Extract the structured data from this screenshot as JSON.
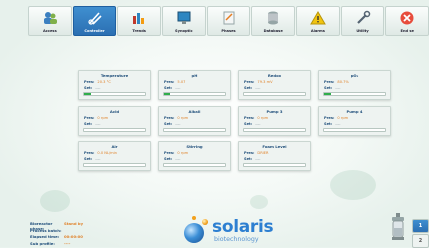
{
  "toolbar": {
    "items": [
      {
        "label": "Access",
        "icon": "people-icon",
        "active": false
      },
      {
        "label": "Controller",
        "icon": "controller-icon",
        "active": true
      },
      {
        "label": "Trends",
        "icon": "trends-icon",
        "active": false
      },
      {
        "label": "Synoptic",
        "icon": "synoptic-icon",
        "active": false
      },
      {
        "label": "Phases",
        "icon": "phases-icon",
        "active": false
      },
      {
        "label": "Database",
        "icon": "database-icon",
        "active": false
      },
      {
        "label": "Alarms",
        "icon": "alarm-icon",
        "active": false
      },
      {
        "label": "Utility",
        "icon": "utility-icon",
        "active": false
      },
      {
        "label": "End se",
        "icon": "end-session-icon",
        "active": false
      }
    ]
  },
  "cards": [
    {
      "title": "Temperature",
      "pres_label": "Pres:",
      "pres_value": "20.3 °C",
      "set_label": "Set:",
      "set_value": "----",
      "fill": 0.12
    },
    {
      "title": "pH",
      "pres_label": "Pres:",
      "pres_value": "5.07",
      "set_label": "Set:",
      "set_value": "----",
      "fill": 0.1
    },
    {
      "title": "Redox",
      "pres_label": "Pres:",
      "pres_value": "79.3 mV",
      "set_label": "Set:",
      "set_value": "----",
      "fill": 0
    },
    {
      "title": "pO₂",
      "pres_label": "Pres:",
      "pres_value": "80.7%",
      "set_label": "Set:",
      "set_value": "----",
      "fill": 0.12
    },
    {
      "title": "Acid",
      "pres_label": "Pres:",
      "pres_value": "0 rpm",
      "set_label": "Set:",
      "set_value": "----",
      "fill": 0
    },
    {
      "title": "Alkali",
      "pres_label": "Pres:",
      "pres_value": "0 rpm",
      "set_label": "Set:",
      "set_value": "----",
      "fill": 0
    },
    {
      "title": "Pump 3",
      "pres_label": "Pres:",
      "pres_value": "0 rpm",
      "set_label": "Set:",
      "set_value": "----",
      "fill": 0
    },
    {
      "title": "Pump 4",
      "pres_label": "Pres:",
      "pres_value": "0 rpm",
      "set_label": "Set:",
      "set_value": "----",
      "fill": 0
    },
    {
      "title": "Air",
      "pres_label": "Pres:",
      "pres_value": "0.0 NL/min",
      "set_label": "Set:",
      "set_value": "----",
      "fill": 0
    },
    {
      "title": "Stirring",
      "pres_label": "Pres:",
      "pres_value": "0 rpm",
      "set_label": "Set:",
      "set_value": "----",
      "fill": 0
    },
    {
      "title": "Foam Level",
      "pres_label": "Pres:",
      "pres_value": "DRIER",
      "set_label": "Set:",
      "set_value": "----",
      "fill": 0
    }
  ],
  "footer": {
    "rows": [
      {
        "key": "Bioreactor phase:",
        "value": "Stand by"
      },
      {
        "key": "Process batch:",
        "value": ""
      },
      {
        "key": "Elapsed time:",
        "value": "00:00:00"
      },
      {
        "key": "Sub profile:",
        "value": "----"
      }
    ],
    "brand": "solaris",
    "brand_sub": "biotechnology"
  },
  "side_buttons": [
    "1",
    "2"
  ],
  "colors": {
    "accent": "#2b6fb2",
    "value": "#e0822a",
    "label": "#1f4e7a",
    "bar_fill": "#2fae4b"
  }
}
